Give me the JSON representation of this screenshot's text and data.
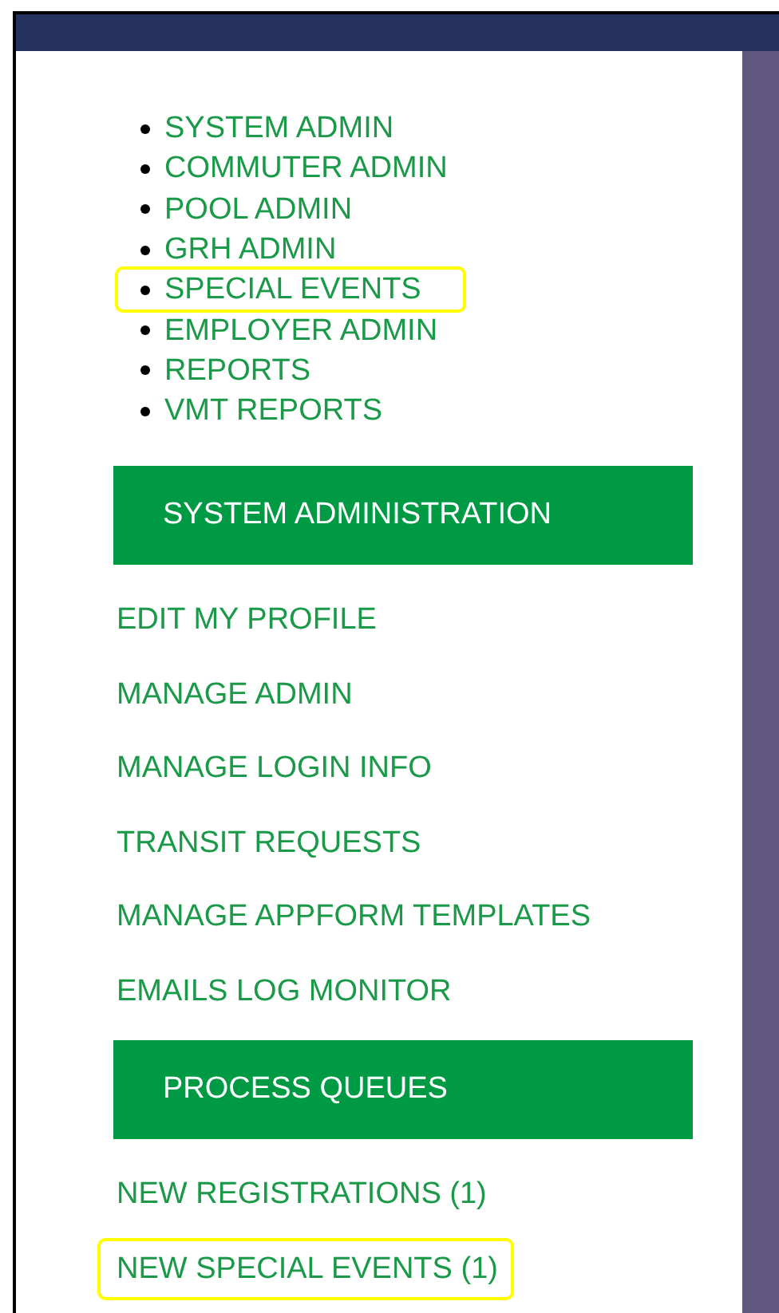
{
  "menu": [
    {
      "label": "SYSTEM ADMIN",
      "highlighted": false
    },
    {
      "label": "COMMUTER ADMIN",
      "highlighted": false
    },
    {
      "label": "POOL ADMIN",
      "highlighted": false
    },
    {
      "label": "GRH ADMIN",
      "highlighted": false
    },
    {
      "label": "SPECIAL EVENTS",
      "highlighted": true
    },
    {
      "label": "EMPLOYER ADMIN",
      "highlighted": false
    },
    {
      "label": "REPORTS",
      "highlighted": false
    },
    {
      "label": "VMT REPORTS",
      "highlighted": false
    }
  ],
  "sections": [
    {
      "title": "SYSTEM ADMINISTRATION",
      "links": [
        {
          "label": "EDIT MY PROFILE",
          "highlighted": false
        },
        {
          "label": "MANAGE ADMIN",
          "highlighted": false
        },
        {
          "label": "MANAGE LOGIN INFO",
          "highlighted": false
        },
        {
          "label": "TRANSIT REQUESTS",
          "highlighted": false
        },
        {
          "label": "MANAGE APPFORM TEMPLATES",
          "highlighted": false
        },
        {
          "label": "EMAILS LOG MONITOR",
          "highlighted": false
        }
      ]
    },
    {
      "title": "PROCESS QUEUES",
      "links": [
        {
          "label": "NEW REGISTRATIONS (1)",
          "highlighted": false
        },
        {
          "label": "NEW SPECIAL EVENTS (1)",
          "highlighted": true
        }
      ]
    }
  ]
}
